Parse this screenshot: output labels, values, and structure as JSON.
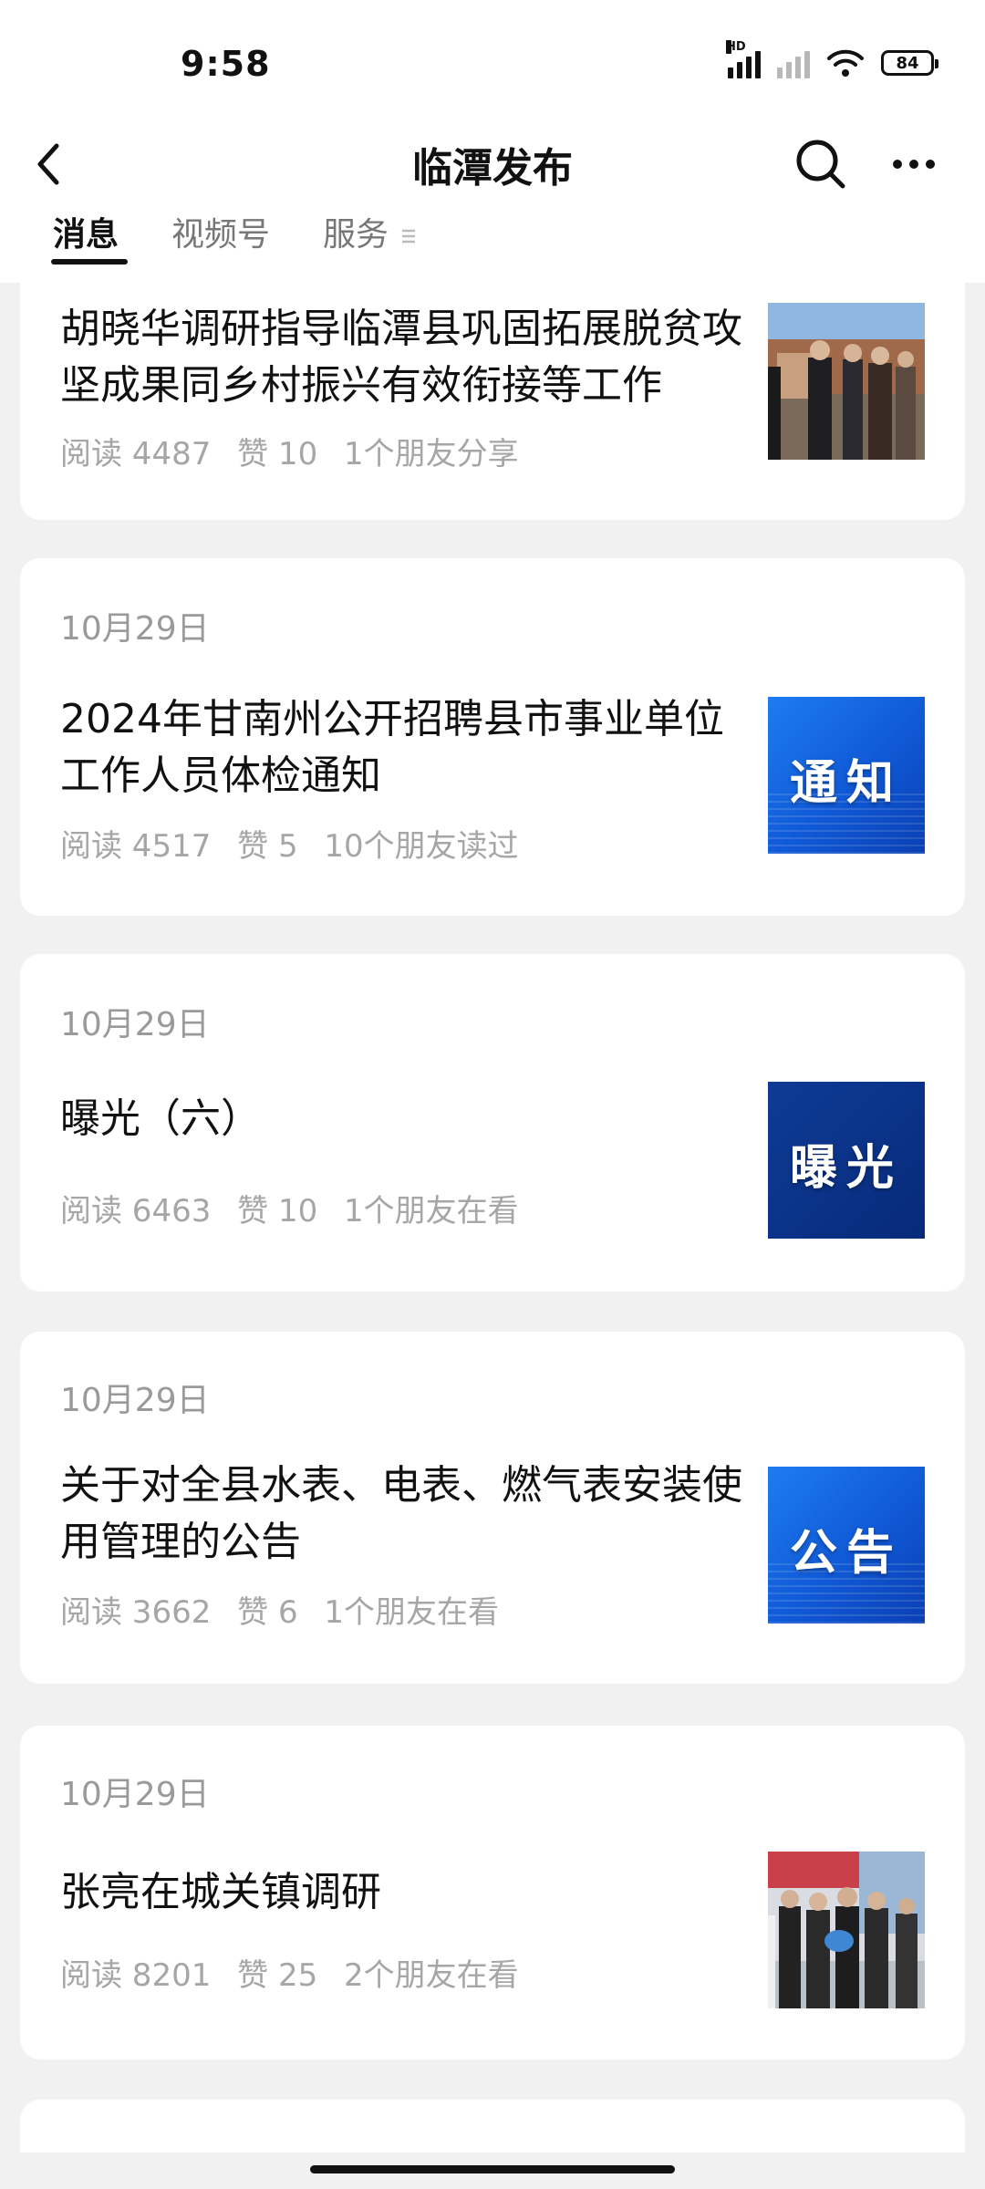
{
  "status_bar": {
    "time": "9:58",
    "hd_label": "HD",
    "battery": "84"
  },
  "nav": {
    "title": "临潭发布"
  },
  "tabs": [
    {
      "label": "消息"
    },
    {
      "label": "视频号"
    },
    {
      "label": "服务"
    }
  ],
  "articles": [
    {
      "date": "",
      "title": "胡晓华调研指导临潭县巩固拓展脱贫攻坚成果同乡村振兴有效衔接等工作",
      "reads": "阅读 4487",
      "likes": "赞 10",
      "friends": "1个朋友分享",
      "thumb_type": "photo"
    },
    {
      "date": "10月29日",
      "title": "2024年甘南州公开招聘县市事业单位工作人员体检通知",
      "reads": "阅读 4517",
      "likes": "赞 5",
      "friends": "10个朋友读过",
      "thumb_type": "notice",
      "thumb_text": "通知"
    },
    {
      "date": "10月29日",
      "title": "曝光（六）",
      "reads": "阅读 6463",
      "likes": "赞 10",
      "friends": "1个朋友在看",
      "thumb_type": "exposure",
      "thumb_text": "曝光"
    },
    {
      "date": "10月29日",
      "title": "关于对全县水表、电表、燃气表安装使用管理的公告",
      "reads": "阅读 3662",
      "likes": "赞 6",
      "friends": "1个朋友在看",
      "thumb_type": "notice",
      "thumb_text": "公告"
    },
    {
      "date": "10月29日",
      "title": "张亮在城关镇调研",
      "reads": "阅读 8201",
      "likes": "赞 25",
      "friends": "2个朋友在看",
      "thumb_type": "photo"
    }
  ]
}
